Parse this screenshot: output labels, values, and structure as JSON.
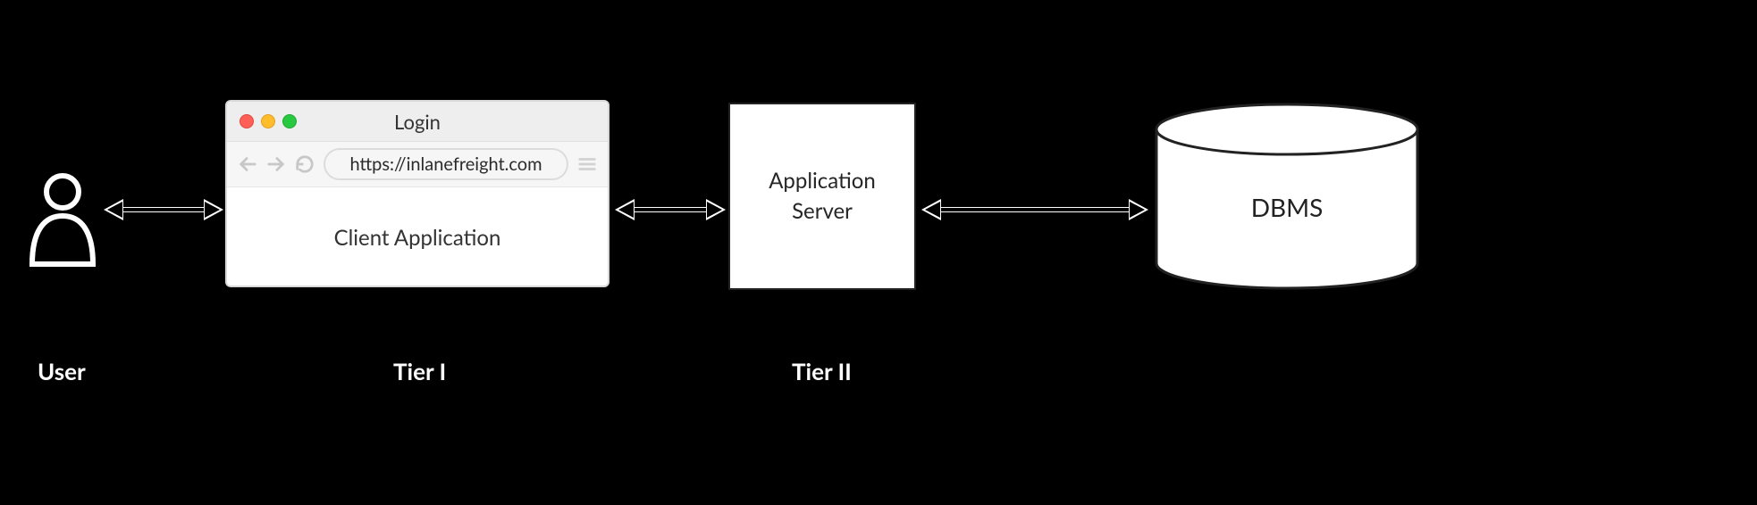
{
  "labels": {
    "user": "User",
    "tier1": "Tier I",
    "tier2": "Tier II"
  },
  "browser": {
    "title": "Login",
    "url": "https://inlanefreight.com",
    "body": "Client Application"
  },
  "appserver": {
    "line1": "Application",
    "line2": "Server"
  },
  "db": {
    "label": "DBMS"
  }
}
